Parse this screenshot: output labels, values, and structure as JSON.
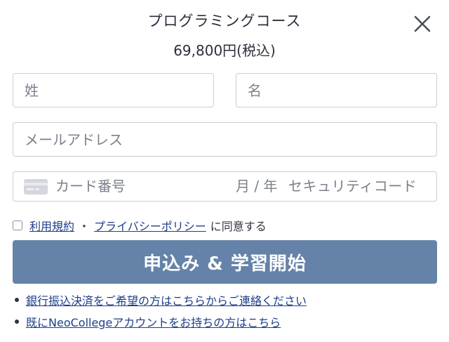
{
  "header": {
    "title": "プログラミングコース",
    "price": "69,800円(税込)"
  },
  "icons": {
    "close": "close-icon",
    "card": "credit-card-icon"
  },
  "form": {
    "last_name_placeholder": "姓",
    "first_name_placeholder": "名",
    "email_placeholder": "メールアドレス",
    "card_number_placeholder": "カード番号",
    "card_expiry_placeholder": "月 / 年",
    "card_cvc_placeholder": "セキュリティコード"
  },
  "agreement": {
    "terms_link": "利用規約",
    "separator": "・",
    "privacy_link": "プライバシーポリシー",
    "suffix": "に同意する",
    "checked": false
  },
  "submit_label": "申込み & 学習開始",
  "links": [
    {
      "label": "銀行振込決済をご希望の方はこちらからご連絡ください"
    },
    {
      "label": "既にNeoCollegeアカウントをお持ちの方はこちら"
    }
  ],
  "colors": {
    "primary_button": "#6583a8",
    "link": "#1d3f8a",
    "border": "#c9cdd6",
    "placeholder": "#7b808c"
  }
}
